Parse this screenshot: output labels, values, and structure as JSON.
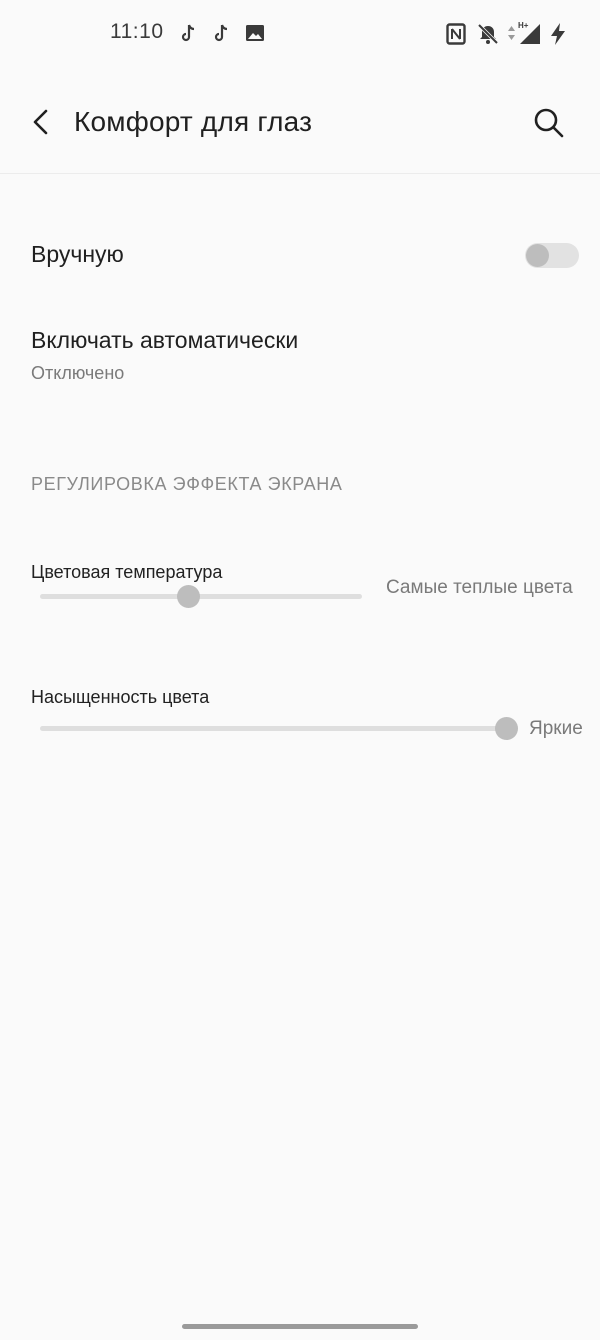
{
  "status_bar": {
    "time": "11:10",
    "icons": [
      "tiktok-icon",
      "tiktok-icon",
      "image-icon",
      "nfc-icon",
      "bell-off-icon",
      "data-arrows-icon",
      "signal-hplus-icon",
      "charging-icon"
    ]
  },
  "app_bar": {
    "title": "Комфорт для глаз",
    "back_icon": "back-arrow-icon",
    "search_icon": "search-icon"
  },
  "settings": {
    "manual": {
      "label": "Вручную",
      "enabled": false
    },
    "auto": {
      "label": "Включать автоматически",
      "summary": "Отключено"
    }
  },
  "section": {
    "header": "РЕГУЛИРОВКА ЭФФЕКТА ЭКРАНА"
  },
  "sliders": [
    {
      "label": "Цветовая температура",
      "value_label": "Самые теплые цвета",
      "position": 0.46
    },
    {
      "label": "Насыщенность цвета",
      "value_label": "Яркие",
      "position": 1.0
    }
  ],
  "colors": {
    "background": "#fafafa",
    "disabled_thumb": "#bdbdbd",
    "track": "#dedede"
  }
}
